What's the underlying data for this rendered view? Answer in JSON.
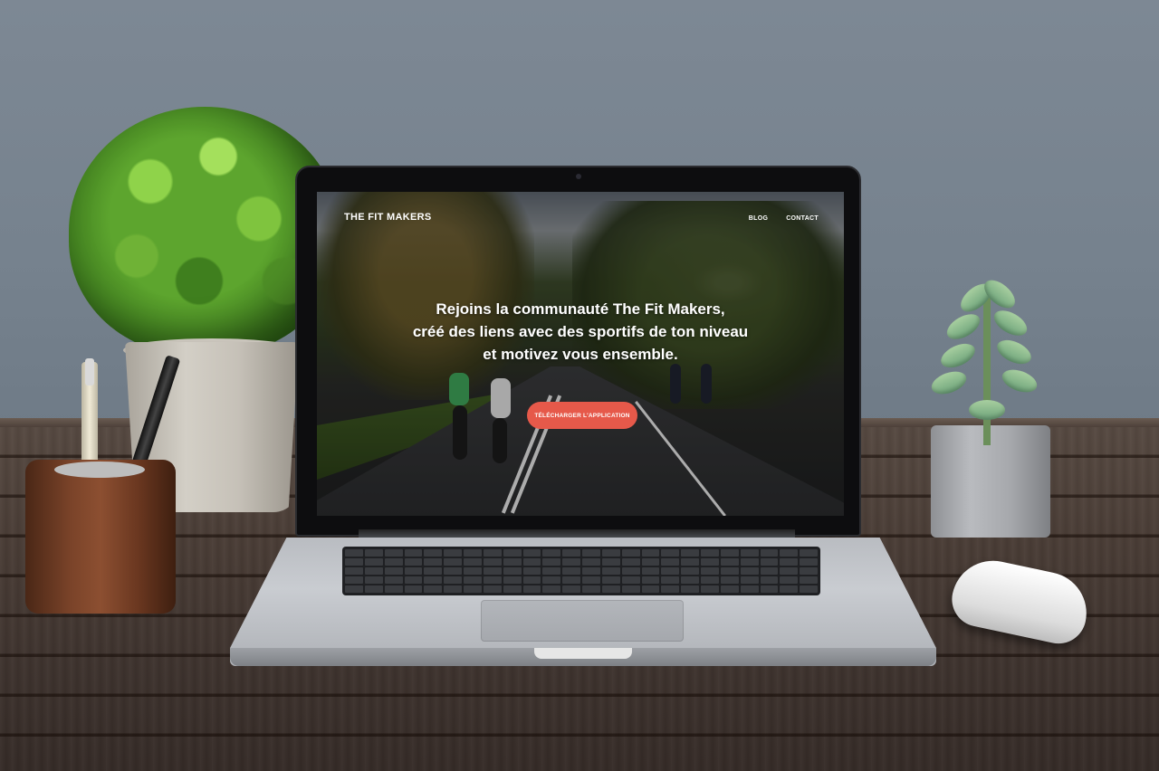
{
  "site": {
    "logo": "THE FIT MAKERS",
    "nav": [
      "BLOG",
      "CONTACT"
    ],
    "headline_lines": [
      "Rejoins la communauté The Fit Makers,",
      "créé des liens avec des sportifs de ton niveau",
      "et motivez vous ensemble."
    ],
    "cta_label": "TÉLÉCHARGER L'APPLICATION"
  },
  "colors": {
    "cta": "#e6594a",
    "text": "#ffffff",
    "wall": "#7b8692",
    "desk": "#4a3d36"
  },
  "icons": {
    "plant_left": "topiary-plant-icon",
    "plant_right": "succulent-plant-icon",
    "pen_holder": "pen-holder-icon",
    "mouse": "mouse-icon"
  }
}
